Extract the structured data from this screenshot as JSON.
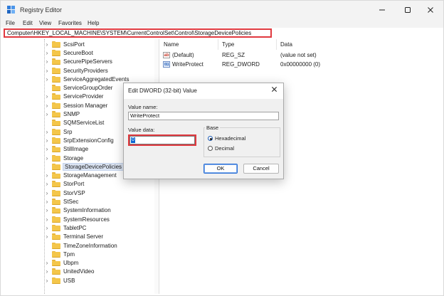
{
  "window": {
    "title": "Registry Editor",
    "app_icon": "regedit-icon"
  },
  "menu": [
    "File",
    "Edit",
    "View",
    "Favorites",
    "Help"
  ],
  "address": "Computer\\HKEY_LOCAL_MACHINE\\SYSTEM\\CurrentControlSet\\Control\\StorageDevicePolicies",
  "tree": {
    "items": [
      {
        "label": "ScsiPort",
        "expandable": true
      },
      {
        "label": "SecureBoot",
        "expandable": true
      },
      {
        "label": "SecurePipeServers",
        "expandable": true
      },
      {
        "label": "SecurityProviders",
        "expandable": true
      },
      {
        "label": "ServiceAggregatedEvents",
        "expandable": true
      },
      {
        "label": "ServiceGroupOrder",
        "expandable": false
      },
      {
        "label": "ServiceProvider",
        "expandable": true
      },
      {
        "label": "Session Manager",
        "expandable": true
      },
      {
        "label": "SNMP",
        "expandable": true
      },
      {
        "label": "SQMServiceList",
        "expandable": false
      },
      {
        "label": "Srp",
        "expandable": true
      },
      {
        "label": "SrpExtensionConfig",
        "expandable": true
      },
      {
        "label": "StillImage",
        "expandable": true
      },
      {
        "label": "Storage",
        "expandable": true
      },
      {
        "label": "StorageDevicePolicies",
        "expandable": false,
        "selected": true
      },
      {
        "label": "StorageManagement",
        "expandable": true
      },
      {
        "label": "StorPort",
        "expandable": true
      },
      {
        "label": "StorVSP",
        "expandable": true
      },
      {
        "label": "StSec",
        "expandable": true
      },
      {
        "label": "SystemInformation",
        "expandable": true
      },
      {
        "label": "SystemResources",
        "expandable": true
      },
      {
        "label": "TabletPC",
        "expandable": true
      },
      {
        "label": "Terminal Server",
        "expandable": true
      },
      {
        "label": "TimeZoneInformation",
        "expandable": false
      },
      {
        "label": "Tpm",
        "expandable": false
      },
      {
        "label": "Ubpm",
        "expandable": true
      },
      {
        "label": "UnitedVideo",
        "expandable": true
      },
      {
        "label": "USB",
        "expandable": true
      }
    ]
  },
  "list": {
    "columns": [
      "Name",
      "Type",
      "Data"
    ],
    "rows": [
      {
        "name": "(Default)",
        "type": "REG_SZ",
        "data": "(value not set)",
        "icon": "string-value-icon"
      },
      {
        "name": "WriteProtect",
        "type": "REG_DWORD",
        "data": "0x00000000 (0)",
        "icon": "dword-value-icon"
      }
    ]
  },
  "dialog": {
    "title": "Edit DWORD (32-bit) Value",
    "value_name_label": "Value name:",
    "value_name": "WriteProtect",
    "value_data_label": "Value data:",
    "value_data": "0",
    "base_label": "Base",
    "base_options": [
      {
        "label": "Hexadecimal",
        "checked": true
      },
      {
        "label": "Decimal",
        "checked": false
      }
    ],
    "ok_label": "OK",
    "cancel_label": "Cancel"
  },
  "colors": {
    "highlight_box": "#e0393f",
    "selection": "#0a64d0",
    "folder": "#f4c64a"
  }
}
